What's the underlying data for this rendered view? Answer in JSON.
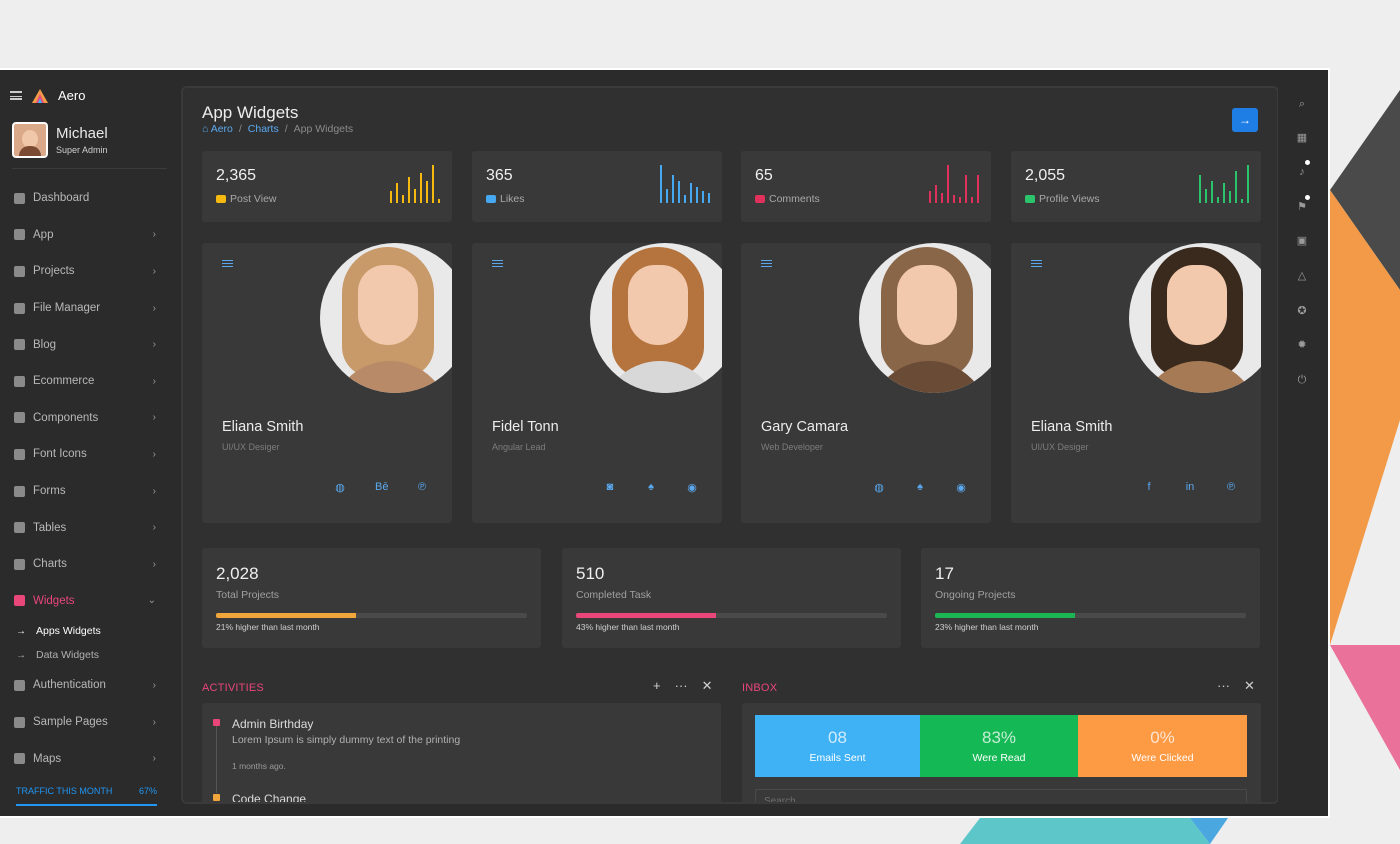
{
  "colors": {
    "accent": "#e9467a",
    "link": "#5aa9f0",
    "primary_button": "#1e7ee6",
    "background_shapes": [
      "#4a4a4a",
      "#f29a47",
      "#e9719a",
      "#5cc6c9",
      "#4aa7e0"
    ]
  },
  "brand": {
    "name": "Aero"
  },
  "profile": {
    "name": "Michael",
    "role": "Super Admin"
  },
  "sidebar": {
    "items": [
      {
        "label": "Dashboard",
        "icon": "home-icon",
        "chevron": false
      },
      {
        "label": "App",
        "icon": "apps-icon",
        "chevron": true
      },
      {
        "label": "Projects",
        "icon": "assignment-icon",
        "chevron": true
      },
      {
        "label": "File Manager",
        "icon": "folder-icon",
        "chevron": true
      },
      {
        "label": "Blog",
        "icon": "blogger-icon",
        "chevron": true
      },
      {
        "label": "Ecommerce",
        "icon": "cart-icon",
        "chevron": true
      },
      {
        "label": "Components",
        "icon": "swap-icon",
        "chevron": true
      },
      {
        "label": "Font Icons",
        "icon": "gear-icon",
        "chevron": true
      },
      {
        "label": "Forms",
        "icon": "assignment-icon",
        "chevron": true
      },
      {
        "label": "Tables",
        "icon": "grid-icon",
        "chevron": true
      },
      {
        "label": "Charts",
        "icon": "chart-icon",
        "chevron": true
      },
      {
        "label": "Widgets",
        "icon": "puzzle-icon",
        "chevron": true,
        "active": true
      }
    ],
    "sub_items": [
      {
        "label": "Apps Widgets",
        "current": true
      },
      {
        "label": "Data Widgets",
        "current": false
      }
    ],
    "items_after": [
      {
        "label": "Authentication",
        "icon": "lock-icon",
        "chevron": true
      },
      {
        "label": "Sample Pages",
        "icon": "copy-icon",
        "chevron": true
      },
      {
        "label": "Maps",
        "icon": "map-icon",
        "chevron": true
      }
    ],
    "traffic": {
      "label": "TRAFFIC THIS MONTH",
      "value": "67%"
    }
  },
  "header": {
    "title": "App Widgets",
    "breadcrumbs": [
      "Aero",
      "Charts",
      "App Widgets"
    ],
    "separator": "/"
  },
  "stats": [
    {
      "value": "2,365",
      "label": "Post View",
      "color": "#f5b90f",
      "icon": "eye-icon",
      "bars": [
        12,
        20,
        8,
        26,
        14,
        30,
        22,
        38,
        4
      ]
    },
    {
      "value": "365",
      "label": "Likes",
      "color": "#45a8f0",
      "icon": "thumbs-up-icon",
      "bars": [
        38,
        14,
        28,
        22,
        8,
        20,
        16,
        12,
        10
      ]
    },
    {
      "value": "65",
      "label": "Comments",
      "color": "#e0305c",
      "icon": "comment-icon",
      "bars": [
        12,
        18,
        10,
        38,
        8,
        6,
        28,
        6,
        28
      ]
    },
    {
      "value": "2,055",
      "label": "Profile Views",
      "color": "#2bc36b",
      "icon": "user-icon",
      "bars": [
        28,
        14,
        22,
        6,
        20,
        12,
        32,
        4,
        38
      ]
    }
  ],
  "profiles": [
    {
      "name": "Eliana Smith",
      "role": "UI/UX Desiger",
      "socials": [
        "dribbble-icon",
        "behance-icon",
        "pinterest-icon"
      ],
      "social_glyphs": [
        "◍",
        "Bē",
        "℗"
      ],
      "hair": "#c89a6a",
      "shirt": "#b98a68"
    },
    {
      "name": "Fidel Tonn",
      "role": "Angular Lead",
      "socials": [
        "instagram-icon",
        "twitter-icon",
        "github-icon"
      ],
      "social_glyphs": [
        "◙",
        "♠",
        "◉"
      ],
      "hair": "#b5733d",
      "shirt": "#d8d8d8"
    },
    {
      "name": "Gary Camara",
      "role": "Web Developer",
      "socials": [
        "dribbble-icon",
        "twitter-icon",
        "github-icon"
      ],
      "social_glyphs": [
        "◍",
        "♠",
        "◉"
      ],
      "hair": "#8a6648",
      "shirt": "#6a4b35"
    },
    {
      "name": "Eliana Smith",
      "role": "UI/UX Desiger",
      "socials": [
        "facebook-icon",
        "linkedin-icon",
        "pinterest-icon"
      ],
      "social_glyphs": [
        "f",
        "in",
        "℗"
      ],
      "hair": "#3a2a1e",
      "shirt": "#a57a55"
    }
  ],
  "progress": [
    {
      "value": "2,028",
      "label": "Total Projects",
      "percent": 45,
      "note": "21% higher than last month",
      "color": "#f0a63a"
    },
    {
      "value": "510",
      "label": "Completed Task",
      "percent": 45,
      "note": "43% higher than last month",
      "color": "#e9467a"
    },
    {
      "value": "17",
      "label": "Ongoing Projects",
      "percent": 45,
      "note": "23% higher than last month",
      "color": "#1bb553"
    }
  ],
  "activities": {
    "title": "ACTIVITIES",
    "items": [
      {
        "title": "Admin Birthday",
        "desc": "Lorem Ipsum is simply dummy text of the printing",
        "time": "1 months ago.",
        "color": "#e9467a"
      },
      {
        "title": "Code Change",
        "color": "#f0a63a"
      }
    ]
  },
  "inbox": {
    "title": "INBOX",
    "tiles": [
      {
        "value": "08",
        "label": "Emails Sent",
        "color": "#3fb1f5"
      },
      {
        "value": "83%",
        "label": "Were Read",
        "color": "#14b854"
      },
      {
        "value": "0%",
        "label": "Were Clicked",
        "color": "#fd9a44"
      }
    ],
    "search_placeholder": "Search"
  },
  "right_bar": [
    "search-icon",
    "grid-icon",
    "bell-icon",
    "flag-icon",
    "calendar-icon",
    "drive-icon",
    "soccer-icon",
    "gear-icon",
    "power-icon"
  ]
}
